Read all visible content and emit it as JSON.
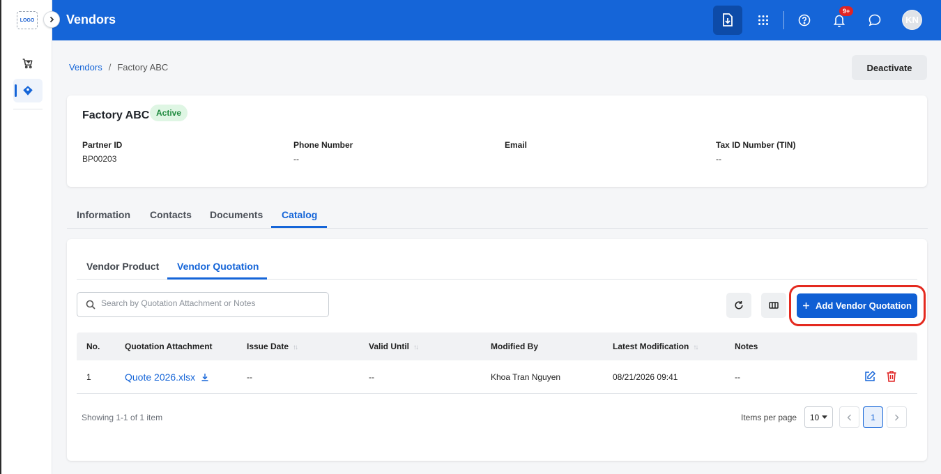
{
  "rail": {
    "logo_text": "LOGO",
    "items": [
      {
        "name": "cart",
        "icon": "cart-icon"
      },
      {
        "name": "vendors",
        "icon": "tag-icon",
        "active": true
      }
    ]
  },
  "topbar": {
    "title": "Vendors",
    "notification_badge": "9+",
    "avatar_initials": "KN",
    "accent_color": "#1565d8"
  },
  "breadcrumb": {
    "parent": "Vendors",
    "separator": "/",
    "current": "Factory ABC"
  },
  "header_actions": {
    "deactivate_label": "Deactivate"
  },
  "vendor": {
    "name": "Factory ABC",
    "status": "Active",
    "fields": [
      {
        "label": "Partner ID",
        "value": "BP00203"
      },
      {
        "label": "Phone Number",
        "value": "--"
      },
      {
        "label": "Email",
        "value": ""
      },
      {
        "label": "Tax ID Number (TIN)",
        "value": "--"
      }
    ]
  },
  "tabs": [
    "Information",
    "Contacts",
    "Documents",
    "Catalog"
  ],
  "active_tab": "Catalog",
  "subtabs": [
    "Vendor Product",
    "Vendor Quotation"
  ],
  "active_subtab": "Vendor Quotation",
  "toolbar": {
    "search_placeholder": "Search by Quotation Attachment or Notes",
    "add_label": "Add Vendor Quotation",
    "add_icon": "plus-icon",
    "refresh_icon": "refresh-icon",
    "columns_icon": "columns-icon"
  },
  "table": {
    "columns": [
      "No.",
      "Quotation Attachment",
      "Issue Date",
      "Valid Until",
      "Modified By",
      "Latest Modification",
      "Notes"
    ],
    "sortable": [
      "Issue Date",
      "Valid Until",
      "Latest Modification"
    ],
    "rows": [
      {
        "no": "1",
        "attachment": "Quote 2026.xlsx",
        "issue_date": "--",
        "valid_until": "--",
        "modified_by": "Khoa Tran Nguyen",
        "latest_modification": "08/21/2026 09:41",
        "notes": "--"
      }
    ]
  },
  "footer": {
    "showing": "Showing 1-1 of 1 item",
    "items_per_page_label": "Items per page",
    "items_per_page": "10",
    "current_page": "1"
  }
}
